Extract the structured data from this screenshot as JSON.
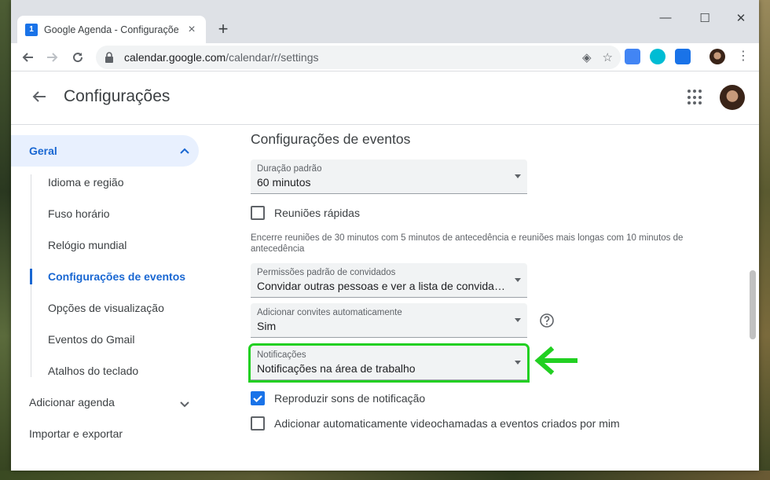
{
  "browser": {
    "tab_title": "Google Agenda - Configurações",
    "tab_favicon_text": "1",
    "url_host": "calendar.google.com",
    "url_path": "/calendar/r/settings",
    "colors": {
      "accent": "#1a73e8",
      "highlight": "#22d022"
    }
  },
  "header": {
    "title": "Configurações"
  },
  "sidebar": {
    "general": "Geral",
    "items": [
      {
        "label": "Idioma e região"
      },
      {
        "label": "Fuso horário"
      },
      {
        "label": "Relógio mundial"
      },
      {
        "label": "Configurações de eventos"
      },
      {
        "label": "Opções de visualização"
      },
      {
        "label": "Eventos do Gmail"
      },
      {
        "label": "Atalhos do teclado"
      }
    ],
    "add_calendar": "Adicionar agenda",
    "import_export": "Importar e exportar"
  },
  "main": {
    "section_title": "Configurações de eventos",
    "default_duration": {
      "label": "Duração padrão",
      "value": "60 minutos"
    },
    "quick_meetings": {
      "label": "Reuniões rápidas",
      "checked": false
    },
    "quick_meetings_help": "Encerre reuniões de 30 minutos com 5 minutos de antecedência e reuniões mais longas com 10 minutos de antecedência",
    "guest_permissions": {
      "label": "Permissões padrão de convidados",
      "value": "Convidar outras pessoas e ver a lista de convidados"
    },
    "auto_invites": {
      "label": "Adicionar convites automaticamente",
      "value": "Sim"
    },
    "notifications": {
      "label": "Notificações",
      "value": "Notificações na área de trabalho"
    },
    "play_sounds": {
      "label": "Reproduzir sons de notificação",
      "checked": true
    },
    "auto_video": {
      "label": "Adicionar automaticamente videochamadas a eventos criados por mim",
      "checked": false
    }
  }
}
